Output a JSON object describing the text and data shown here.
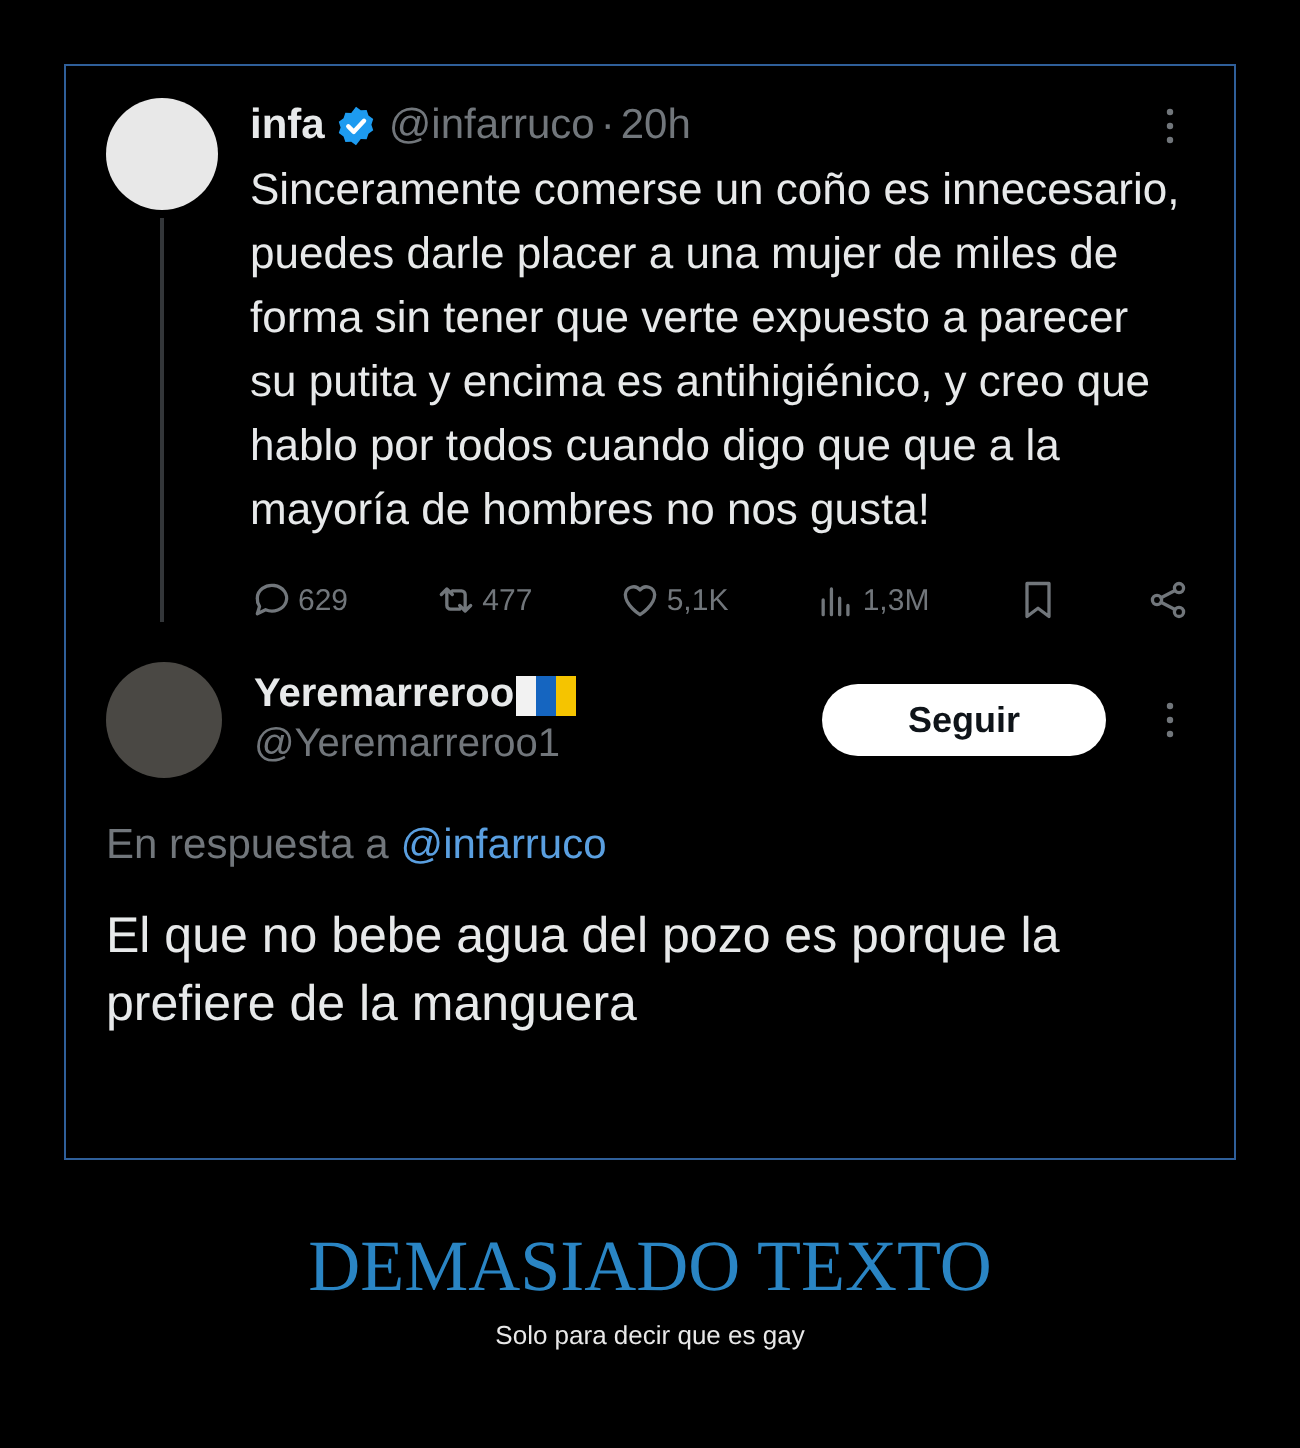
{
  "tweet": {
    "name": "infa",
    "verified": true,
    "handle": "@infarruco",
    "separator": "·",
    "time": "20h",
    "text": "Sinceramente comerse un coño es innecesario, puedes darle placer a una mujer de miles de forma sin tener que verte expuesto a parecer su putita y encima es antihigiénico, y creo que hablo por todos cuando digo que que a la mayoría de hombres no nos gusta!",
    "stats": [
      {
        "kind": "reply",
        "count": "629"
      },
      {
        "kind": "repost",
        "count": "477"
      },
      {
        "kind": "like",
        "count": "5,1K"
      },
      {
        "kind": "views",
        "count": "1,3M"
      },
      {
        "kind": "bookmark"
      },
      {
        "kind": "share"
      }
    ]
  },
  "reply": {
    "name": "Yeremarreroo",
    "handle": "@Yeremarreroo1",
    "follow_button": "Seguir",
    "in_reply_label": "En respuesta a",
    "in_reply_handle": "@infarruco",
    "text": "El que no bebe agua del pozo es porque la prefiere de la manguera"
  },
  "caption": {
    "title": "DEMASIADO TEXTO",
    "subtitle": "Solo para decir que es gay"
  }
}
